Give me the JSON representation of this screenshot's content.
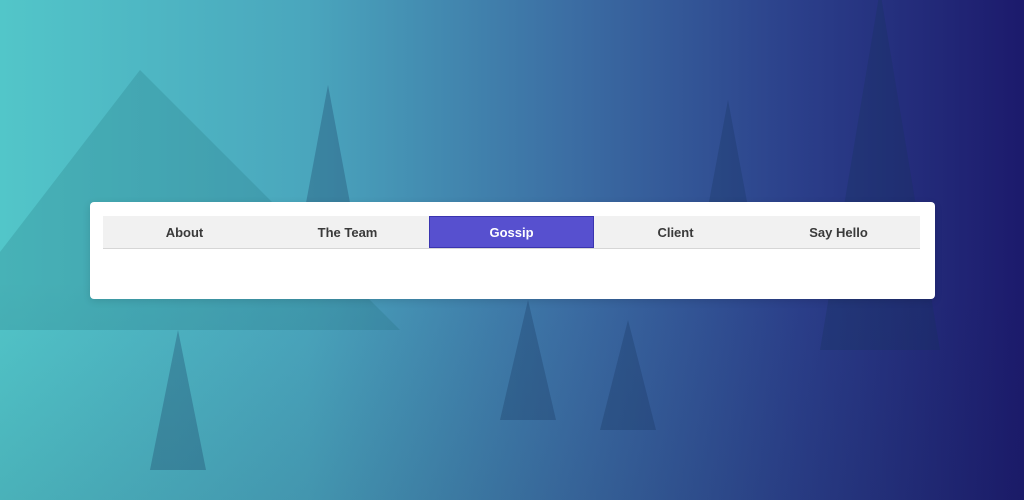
{
  "colors": {
    "gradient_start": "#52c6c9",
    "gradient_end": "#1c1a6c",
    "card_background": "#ffffff",
    "tab_bar_background": "#f1f1f1",
    "active_tab": "#5750cf",
    "tab_text": "#3a3a3a",
    "active_tab_text": "#ffffff"
  },
  "tabs": [
    {
      "label": "About",
      "active": false
    },
    {
      "label": "The Team",
      "active": false
    },
    {
      "label": "Gossip",
      "active": true
    },
    {
      "label": "Client",
      "active": false
    },
    {
      "label": "Say Hello",
      "active": false
    }
  ],
  "tab_content": {
    "text": ""
  }
}
